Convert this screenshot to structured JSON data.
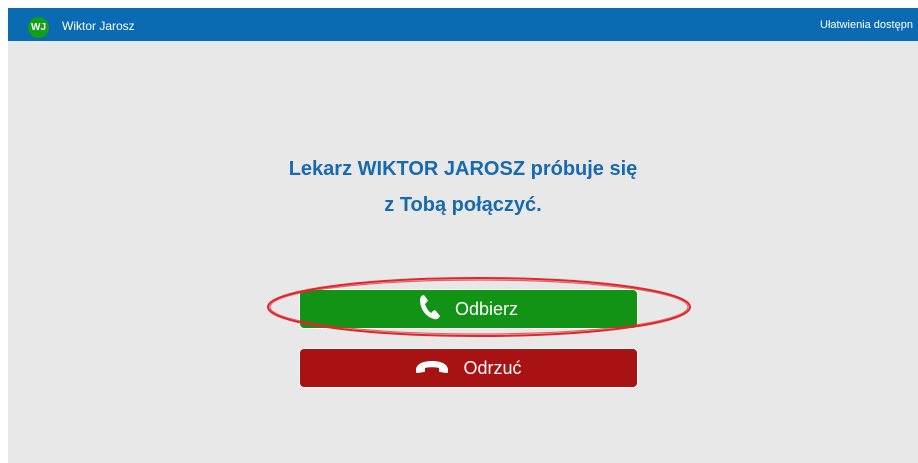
{
  "topbar": {
    "avatar_initials": "WJ",
    "user_name": "Wiktor Jarosz",
    "accessibility_label": "Ułatwienia dostępn"
  },
  "call": {
    "message_line1": "Lekarz WIKTOR JAROSZ próbuje się",
    "message_line2": "z Tobą połączyć.",
    "accept_label": "Odbierz",
    "reject_label": "Odrzuć",
    "accept_icon": "phone-icon",
    "reject_icon": "hang-up-icon"
  },
  "colors": {
    "topbar": "#0a6bb2",
    "background": "#e8e8e8",
    "message": "#1769b0",
    "accept": "#139315",
    "reject": "#a81212",
    "avatar": "#12a018",
    "highlight": "#e0262b"
  }
}
